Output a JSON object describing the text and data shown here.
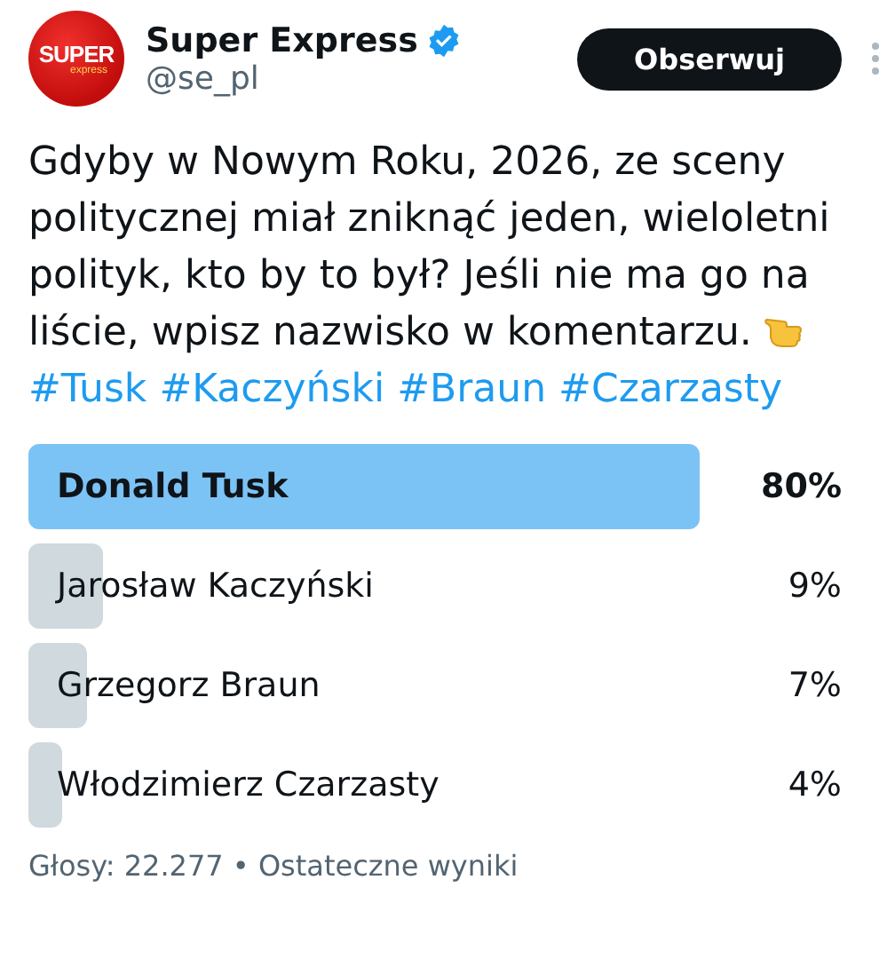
{
  "author": {
    "logo": {
      "top": "SUPER",
      "bottom": "express"
    },
    "name": "Super Express",
    "verified": true,
    "handle": "@se_pl"
  },
  "follow_button": "Obserwuj",
  "text": "Gdyby w Nowym Roku, 2026, ze sceny politycznej miał zniknąć jeden, wieloletni polityk, kto by to był? Jeśli nie ma go na liście, wpisz nazwisko w komentarzu.",
  "hashtags": [
    "#Tusk",
    "#Kaczyński",
    "#Braun",
    "#Czarzasty"
  ],
  "poll": {
    "options": [
      {
        "label": "Donald Tusk",
        "percent": "80%",
        "winner": true
      },
      {
        "label": "Jarosław Kaczyński",
        "percent": "9%",
        "winner": false
      },
      {
        "label": "Grzegorz Braun",
        "percent": "7%",
        "winner": false
      },
      {
        "label": "Włodzimierz Czarzasty",
        "percent": "4%",
        "winner": false
      }
    ],
    "summary": "Głosy: 22.277 • Ostateczne wyniki"
  }
}
